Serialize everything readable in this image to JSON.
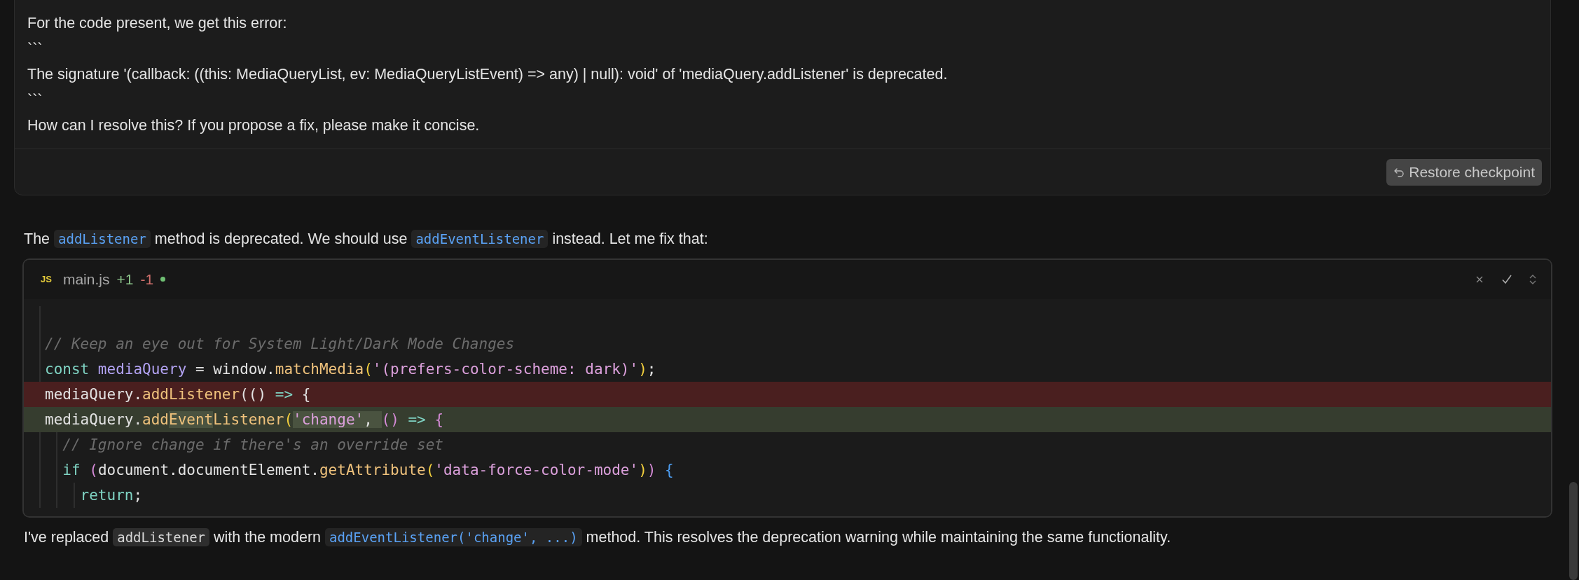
{
  "user_message": {
    "lines": [
      "For the code present, we get this error:",
      "```",
      "The signature '(callback: ((this: MediaQueryList, ev: MediaQueryListEvent) => any) | null): void' of 'mediaQuery.addListener' is deprecated.",
      "```",
      "How can I resolve this? If you propose a fix, please make it concise."
    ],
    "restore_button": {
      "label": "Restore checkpoint"
    }
  },
  "intro": [
    {
      "kind": "text",
      "text": "The "
    },
    {
      "kind": "code",
      "text": "addListener"
    },
    {
      "kind": "text",
      "text": " method is deprecated. We should use "
    },
    {
      "kind": "code",
      "text": "addEventListener"
    },
    {
      "kind": "text",
      "text": " instead. Let me fix that:"
    }
  ],
  "code_block": {
    "file_badge": "JS",
    "file_name": "main.js",
    "added": "+1",
    "removed": "-1",
    "modified": true,
    "lines": [
      {
        "kind": "context"
      },
      {
        "kind": "context",
        "tokens": [
          {
            "kind": "comment",
            "text": "// Keep an eye out for System Light/Dark Mode Changes"
          }
        ]
      },
      {
        "kind": "context",
        "tokens": [
          {
            "kind": "keyword",
            "text": "const"
          },
          {
            "kind": "variable",
            "text": " mediaQuery"
          },
          {
            "kind": "plain",
            "text": " = window."
          },
          {
            "kind": "function",
            "text": "matchMedia"
          },
          {
            "kind": "bracket1",
            "text": "("
          },
          {
            "kind": "string",
            "text": "'(prefers-color-scheme: dark)'"
          },
          {
            "kind": "bracket1",
            "text": ")"
          },
          {
            "kind": "plain",
            "text": ";"
          }
        ]
      },
      {
        "kind": "removed",
        "tokens": [
          {
            "kind": "plain",
            "text": "mediaQuery."
          },
          {
            "kind": "function",
            "text": "addListener"
          },
          {
            "kind": "plain",
            "text": "(() "
          },
          {
            "kind": "keyword",
            "text": "=>"
          },
          {
            "kind": "plain",
            "text": " {"
          }
        ]
      },
      {
        "kind": "added",
        "tokens": [
          {
            "kind": "plain",
            "text": "mediaQuery."
          },
          {
            "kind": "function",
            "text": "add",
            "changed": false
          },
          {
            "kind": "function",
            "text": "Event",
            "changed": true
          },
          {
            "kind": "function",
            "text": "Listener",
            "changed": false
          },
          {
            "kind": "bracket1",
            "text": "("
          },
          {
            "kind": "string",
            "text": "'change'",
            "changed": true
          },
          {
            "kind": "plain",
            "text": ", ",
            "changed": true
          },
          {
            "kind": "bracket2",
            "text": "()"
          },
          {
            "kind": "keyword",
            "text": " => "
          },
          {
            "kind": "bracket2",
            "text": "{"
          }
        ]
      },
      {
        "kind": "context",
        "tokens": [
          {
            "kind": "comment",
            "text": "  // Ignore change if there's an override set"
          }
        ]
      },
      {
        "kind": "context",
        "tokens": [
          {
            "kind": "keyword",
            "text": "  if "
          },
          {
            "kind": "bracket2",
            "text": "("
          },
          {
            "kind": "plain",
            "text": "document.documentElement."
          },
          {
            "kind": "function",
            "text": "getAttribute"
          },
          {
            "kind": "bracket1",
            "text": "("
          },
          {
            "kind": "string",
            "text": "'data-force-color-mode'"
          },
          {
            "kind": "bracket1",
            "text": ")"
          },
          {
            "kind": "bracket2",
            "text": ")"
          },
          {
            "kind": "bracket3",
            "text": " {"
          }
        ]
      },
      {
        "kind": "context",
        "tokens": [
          {
            "kind": "keyword",
            "text": "    return"
          },
          {
            "kind": "plain",
            "text": ";"
          }
        ]
      }
    ]
  },
  "outro": [
    {
      "kind": "text",
      "text": "I've replaced "
    },
    {
      "kind": "code",
      "text": "addListener"
    },
    {
      "kind": "text",
      "text": " with the modern "
    },
    {
      "kind": "code",
      "text": "addEventListener('change', ...)"
    },
    {
      "kind": "text",
      "text": " method. This resolves the deprecation warning while maintaining the same functionality."
    }
  ]
}
